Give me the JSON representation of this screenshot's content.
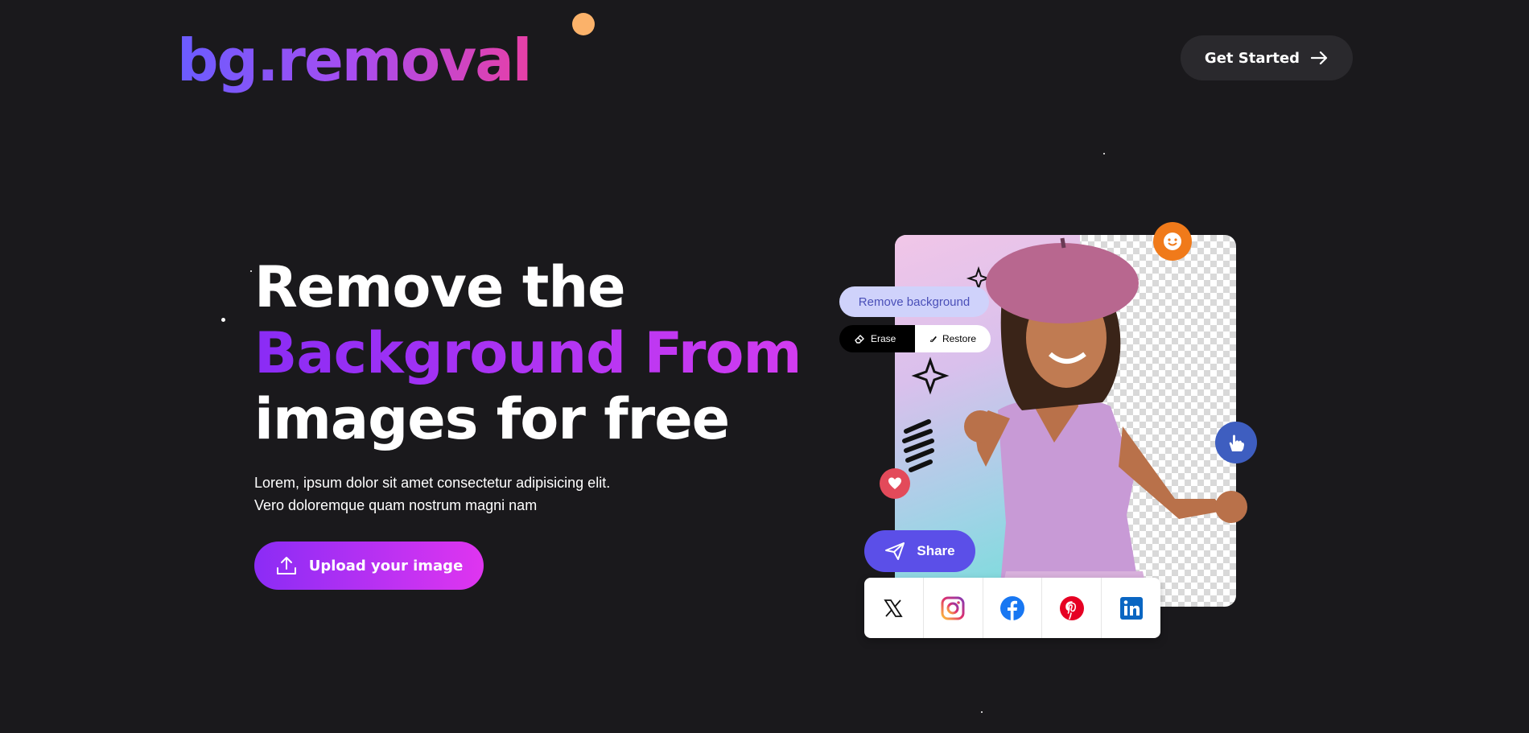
{
  "header": {
    "logo": "bg.removal",
    "cta_label": "Get Started"
  },
  "hero": {
    "headline_line1": "Remove the",
    "headline_line2": "Background From",
    "headline_line3": "images for free",
    "description_line1": "Lorem, ipsum dolor sit amet consectetur adipisicing elit.",
    "description_line2": "Vero doloremque quam nostrum magni nam",
    "upload_label": "Upload your image"
  },
  "illustration": {
    "remove_bg_label": "Remove background",
    "erase_label": "Erase",
    "restore_label": "Restore",
    "share_label": "Share",
    "social_icons": [
      "x-icon",
      "instagram-icon",
      "facebook-icon",
      "pinterest-icon",
      "linkedin-icon"
    ]
  },
  "colors": {
    "background": "#1a191c",
    "accent_purple": "#8b2cf5",
    "accent_pink": "#df35f0",
    "share_blue": "#5b4fe8",
    "dot_orange": "#fbb26a"
  }
}
